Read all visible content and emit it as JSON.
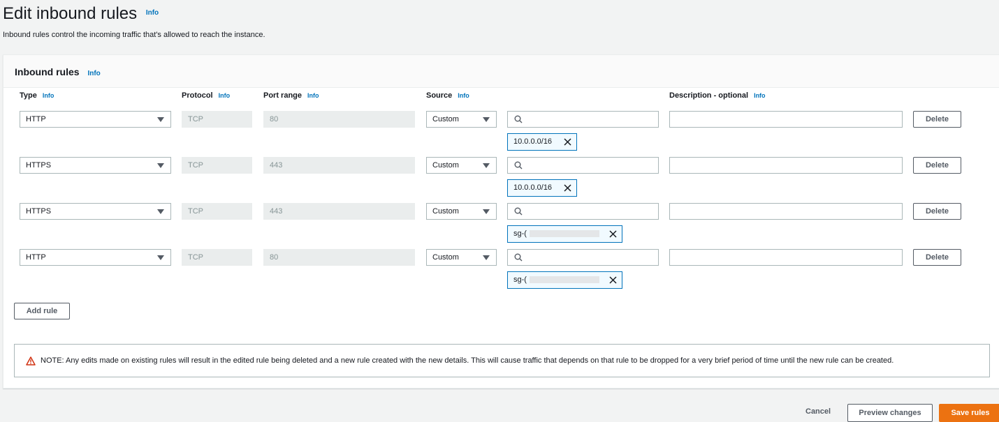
{
  "header": {
    "title": "Edit inbound rules",
    "info": "Info",
    "description": "Inbound rules control the incoming traffic that's allowed to reach the instance."
  },
  "panel": {
    "title": "Inbound rules",
    "info": "Info",
    "columns": {
      "type": "Type",
      "protocol": "Protocol",
      "port_range": "Port range",
      "source": "Source",
      "description": "Description - optional",
      "info": "Info"
    }
  },
  "rules": [
    {
      "type": "HTTP",
      "protocol": "TCP",
      "port_range": "80",
      "source": "Custom",
      "search_value": "",
      "token": "10.0.0.0/16",
      "description": "",
      "delete_label": "Delete"
    },
    {
      "type": "HTTPS",
      "protocol": "TCP",
      "port_range": "443",
      "source": "Custom",
      "search_value": "",
      "token": "10.0.0.0/16",
      "description": "",
      "delete_label": "Delete"
    },
    {
      "type": "HTTPS",
      "protocol": "TCP",
      "port_range": "443",
      "source": "Custom",
      "search_value": "",
      "token": "sg-(",
      "description": "",
      "delete_label": "Delete"
    },
    {
      "type": "HTTP",
      "protocol": "TCP",
      "port_range": "80",
      "source": "Custom",
      "search_value": "",
      "token": "sg-(",
      "description": "",
      "delete_label": "Delete"
    }
  ],
  "add_rule_label": "Add rule",
  "note": "NOTE: Any edits made on existing rules will result in the edited rule being deleted and a new rule created with the new details. This will cause traffic that depends on that rule to be dropped for a very brief period of time until the new rule can be created.",
  "footer": {
    "cancel": "Cancel",
    "preview": "Preview changes",
    "save": "Save rules"
  },
  "colors": {
    "primary": "#ec7211",
    "link": "#0073bb",
    "warning": "#d13212"
  }
}
